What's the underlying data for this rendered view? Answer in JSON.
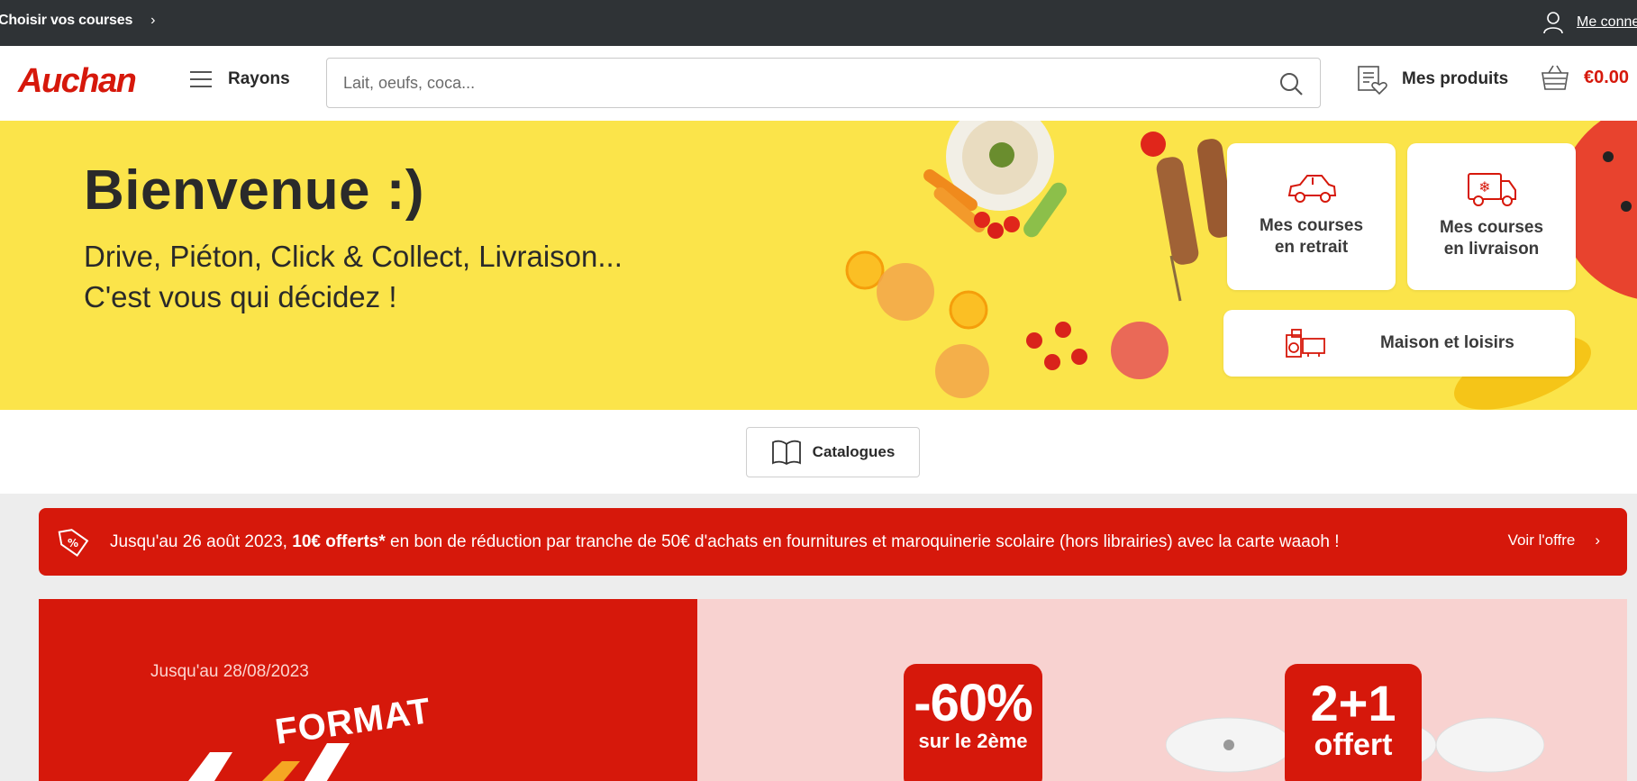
{
  "topbar": {
    "choose_label": "Choisir vos courses",
    "login_label": "Me connecter"
  },
  "header": {
    "logo": "Auchan",
    "rayons_label": "Rayons",
    "search_placeholder": "Lait, oeufs, coca...",
    "mes_produits_label": "Mes produits",
    "cart_total": "€0.00"
  },
  "hero": {
    "title": "Bienvenue :)",
    "subtitle_line1": "Drive, Piéton, Click & Collect, Livraison...",
    "subtitle_line2": "C'est vous qui décidez !",
    "cards": [
      {
        "line1": "Mes courses",
        "line2": "en retrait",
        "icon": "car-icon"
      },
      {
        "line1": "Mes courses",
        "line2": "en livraison",
        "icon": "delivery-truck-icon"
      },
      {
        "label": "Maison et loisirs",
        "icon": "appliances-icon"
      }
    ]
  },
  "catalogues_label": "Catalogues",
  "promo_banner": {
    "text_before": "Jusqu'au 26 août 2023, ",
    "text_bold": "10€ offerts*",
    "text_after": " en bon de réduction par tranche de 50€ d'achats en fournitures et maroquinerie scolaire (hors librairies) avec la carte waaoh !",
    "cta": "Voir l'offre"
  },
  "promo_tiles": {
    "date": "Jusqu'au 28/08/2023",
    "format_label": "FORMAT",
    "discount_big": "-60%",
    "discount_small": "sur le 2ème",
    "offer_big": "2+1",
    "offer_small": "offert"
  },
  "colors": {
    "brand_red": "#d6180b",
    "hero_yellow": "#fbe44a",
    "topbar_dark": "#2f3336"
  }
}
